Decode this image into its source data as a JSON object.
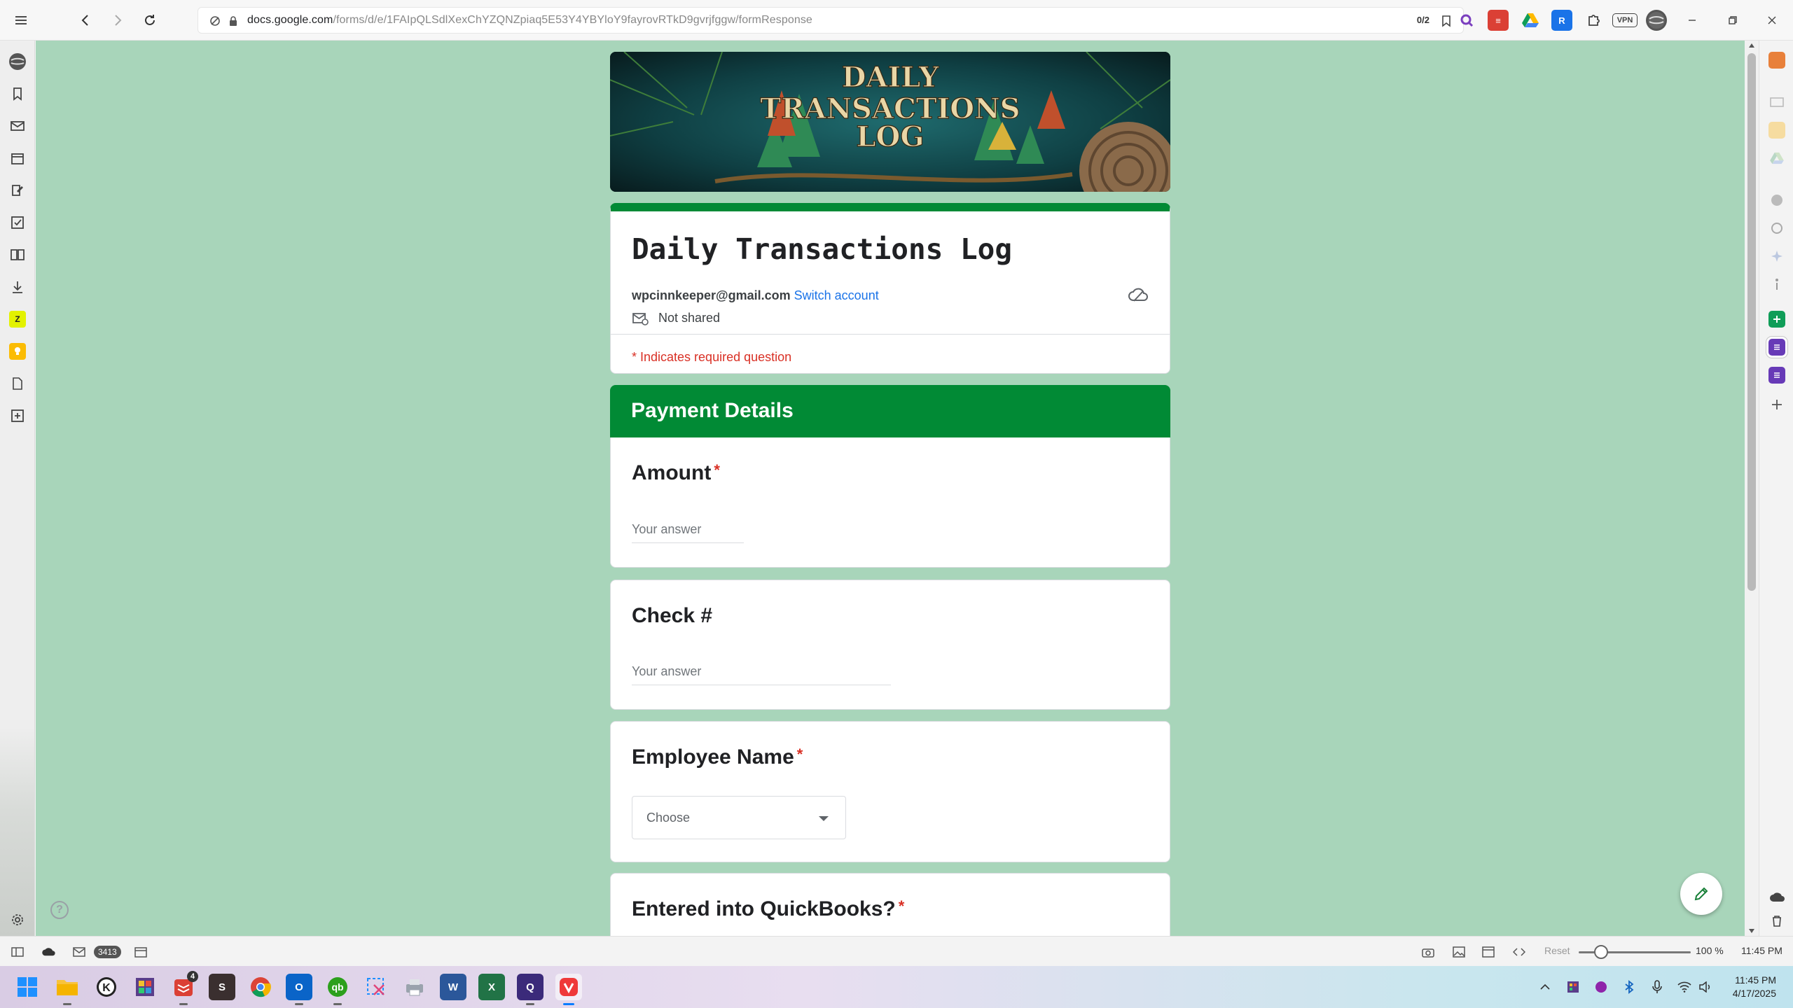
{
  "browser": {
    "url_host": "docs.google.com",
    "url_path": "/forms/d/e/1FAIpQLSdlXexChYZQNZpiaq5E53Y4YBYloY9fayrovRTkD9gvrjfggw/formResponse",
    "tab_counter": "0/2",
    "vpn_label": "VPN"
  },
  "banner": {
    "line1": "DAILY",
    "line2": "TRANSACTIONS",
    "line3": "LOG"
  },
  "form": {
    "title": "Daily Transactions Log",
    "account_email": "wpcinnkeeper@gmail.com",
    "switch_account": "Switch account",
    "sharing_status": "Not shared",
    "required_note": "* Indicates required question"
  },
  "section": {
    "title": "Payment Details"
  },
  "questions": [
    {
      "label": "Amount",
      "required": "*",
      "placeholder": "Your answer"
    },
    {
      "label": "Check #",
      "placeholder": "Your answer"
    },
    {
      "label": "Employee Name",
      "required": "*",
      "select_value": "Choose"
    },
    {
      "label": "Entered into QuickBooks?",
      "required": "*"
    }
  ],
  "statusbar": {
    "mail_count": "3413",
    "reset_label": "Reset",
    "zoom": "100 %",
    "time": "11:45 PM"
  },
  "taskbar": {
    "notification_badge": "4",
    "clock_time": "11:45 PM",
    "clock_date": "4/17/2025"
  },
  "colors": {
    "form_background": "#a8d5ba",
    "theme_green": "#018a35",
    "required_red": "#d93025",
    "link_blue": "#1a73e8"
  }
}
